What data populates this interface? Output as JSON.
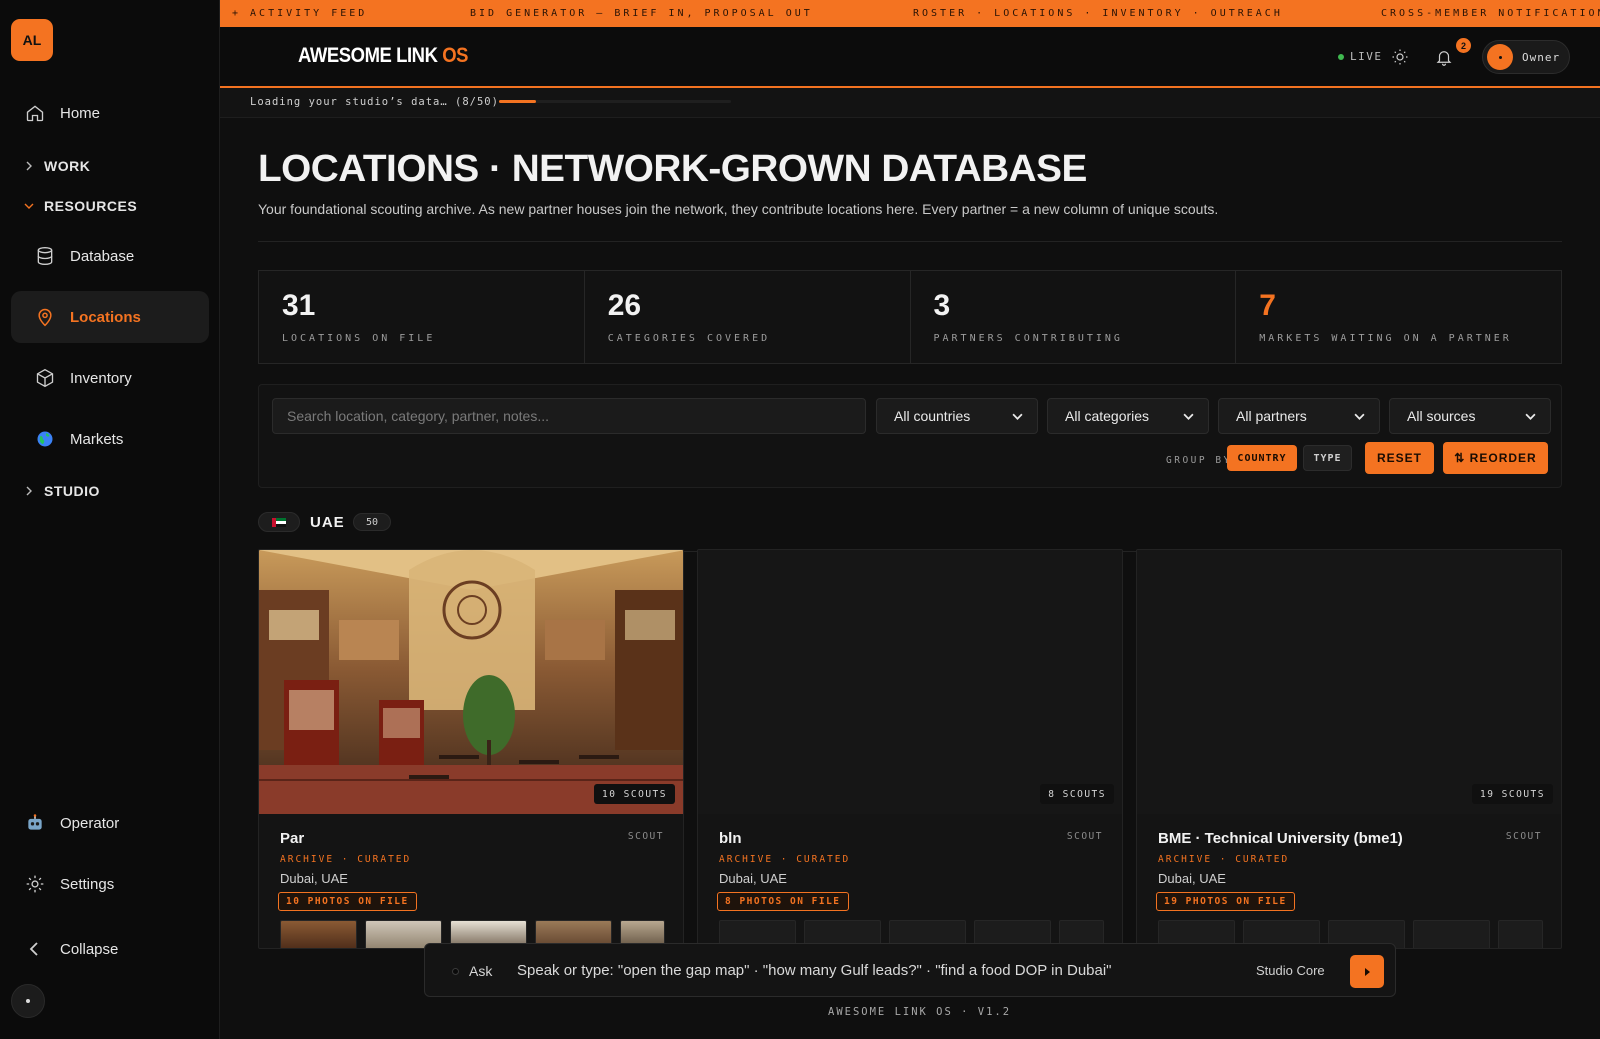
{
  "sidebar": {
    "logo": "AL",
    "items": [
      {
        "label": "Home"
      },
      {
        "label": "WORK"
      },
      {
        "label": "RESOURCES"
      },
      {
        "label": "Database"
      },
      {
        "label": "Locations"
      },
      {
        "label": "Inventory"
      },
      {
        "label": "Markets"
      },
      {
        "label": "STUDIO"
      }
    ],
    "bottom": [
      {
        "label": "Operator"
      },
      {
        "label": "Settings"
      },
      {
        "label": "Collapse"
      }
    ]
  },
  "ticker": [
    "+ ACTIVITY FEED",
    "BID GENERATOR — BRIEF IN, PROPOSAL OUT",
    "ROSTER · LOCATIONS · INVENTORY · OUTREACH",
    "CROSS-MEMBER NOTIFICATIONS"
  ],
  "header": {
    "brand": "AWESOME LINK",
    "brand_accent": "OS",
    "live": "LIVE",
    "notifications": "2",
    "user": "Owner"
  },
  "loading": {
    "text": "Loading your studio’s data… (8/50)",
    "progress": 0.16
  },
  "page": {
    "title": "LOCATIONS · NETWORK-GROWN DATABASE",
    "subtitle": "Your foundational scouting archive. As new partner houses join the network, they contribute locations here. Every partner = a new column of unique scouts."
  },
  "stats": [
    {
      "value": "31",
      "label": "LOCATIONS ON FILE"
    },
    {
      "value": "26",
      "label": "CATEGORIES COVERED"
    },
    {
      "value": "3",
      "label": "PARTNERS CONTRIBUTING"
    },
    {
      "value": "7",
      "label": "MARKETS WAITING ON A PARTNER"
    }
  ],
  "filters": {
    "search_placeholder": "Search location, category, partner, notes...",
    "country": "All countries",
    "category": "All categories",
    "partner": "All partners",
    "source": "All sources",
    "group_by_label": "GROUP BY",
    "group_country": "COUNTRY",
    "group_type": "TYPE",
    "reset": "RESET",
    "reorder": "⇅ REORDER"
  },
  "group": {
    "name": "UAE",
    "count": "50"
  },
  "cards": [
    {
      "name": "Par",
      "scouts": "10 SCOUTS",
      "tag": "SCOUT",
      "meta": "ARCHIVE · CURATED",
      "location": "Dubai, UAE",
      "photos": "10 PHOTOS ON FILE"
    },
    {
      "name": "bln",
      "scouts": "8 SCOUTS",
      "tag": "SCOUT",
      "meta": "ARCHIVE · CURATED",
      "location": "Dubai, UAE",
      "photos": "8 PHOTOS ON FILE"
    },
    {
      "name": "BME · Technical University (bme1)",
      "scouts": "19 SCOUTS",
      "tag": "SCOUT",
      "meta": "ARCHIVE · CURATED",
      "location": "Dubai, UAE",
      "photos": "19 PHOTOS ON FILE"
    }
  ],
  "ask": {
    "label": "Ask",
    "prompt": "Speak or type: \"open the gap map\" · \"how many Gulf leads?\" · \"find a food DOP in Dubai\"",
    "core": "Studio Core"
  },
  "footer": "AWESOME LINK OS · V1.2",
  "colors": {
    "accent": "#f47321",
    "background": "#0f0f0f",
    "live": "#3fb950"
  }
}
